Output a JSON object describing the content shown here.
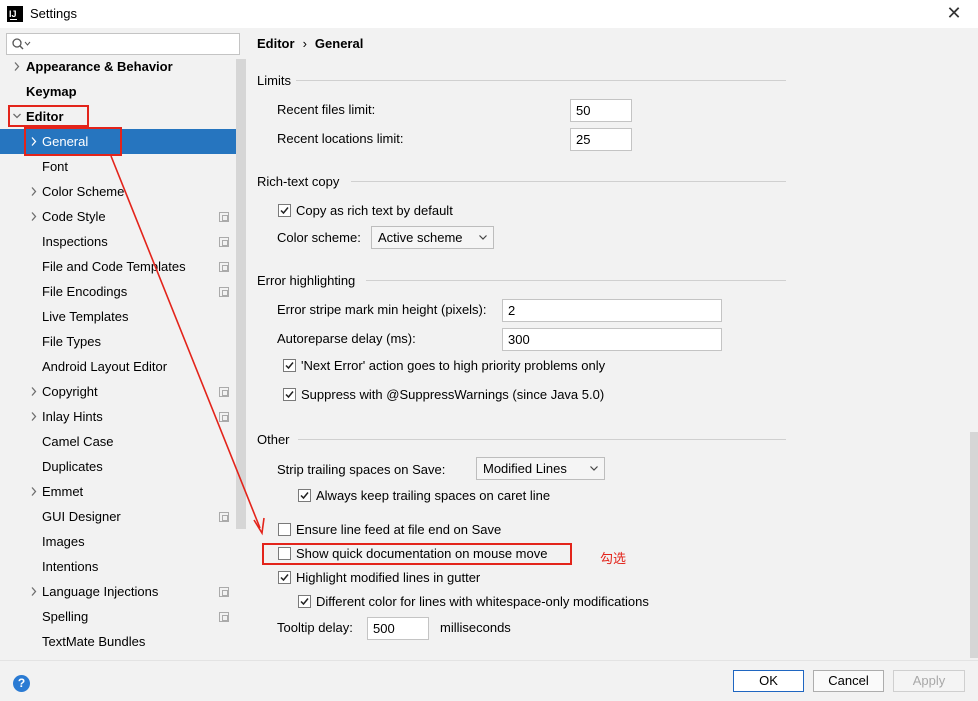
{
  "window": {
    "title": "Settings",
    "app_icon_text": "IJ"
  },
  "search": {
    "placeholder": ""
  },
  "sidebar": {
    "items": [
      {
        "label": "Appearance & Behavior",
        "bold": true,
        "chevron": "right"
      },
      {
        "label": "Keymap",
        "bold": true
      },
      {
        "label": "Editor",
        "bold": true,
        "chevron": "down"
      },
      {
        "label": "General",
        "chevron": "right",
        "selected": true
      },
      {
        "label": "Font"
      },
      {
        "label": "Color Scheme",
        "chevron": "right"
      },
      {
        "label": "Code Style",
        "chevron": "right",
        "project_icon": true
      },
      {
        "label": "Inspections",
        "project_icon": true
      },
      {
        "label": "File and Code Templates",
        "project_icon": true
      },
      {
        "label": "File Encodings",
        "project_icon": true
      },
      {
        "label": "Live Templates"
      },
      {
        "label": "File Types"
      },
      {
        "label": "Android Layout Editor"
      },
      {
        "label": "Copyright",
        "chevron": "right",
        "project_icon": true
      },
      {
        "label": "Inlay Hints",
        "chevron": "right",
        "project_icon": true
      },
      {
        "label": "Camel Case"
      },
      {
        "label": "Duplicates"
      },
      {
        "label": "Emmet",
        "chevron": "right"
      },
      {
        "label": "GUI Designer",
        "project_icon": true
      },
      {
        "label": "Images"
      },
      {
        "label": "Intentions"
      },
      {
        "label": "Language Injections",
        "chevron": "right",
        "project_icon": true
      },
      {
        "label": "Spelling",
        "project_icon": true
      },
      {
        "label": "TextMate Bundles"
      }
    ]
  },
  "breadcrumb": {
    "parent": "Editor",
    "separator": "›",
    "current": "General"
  },
  "limits": {
    "title": "Limits",
    "recent_files_label": "Recent files limit:",
    "recent_files_value": "50",
    "recent_locations_label": "Recent locations limit:",
    "recent_locations_value": "25"
  },
  "rich_text": {
    "title": "Rich-text copy",
    "copy_rich_label": "Copy as rich text by default",
    "copy_rich_checked": true,
    "color_scheme_label": "Color scheme:",
    "color_scheme_value": "Active scheme"
  },
  "error_highlighting": {
    "title": "Error highlighting",
    "stripe_label": "Error stripe mark min height (pixels):",
    "stripe_value": "2",
    "autoreparse_label": "Autoreparse delay (ms):",
    "autoreparse_value": "300",
    "next_error_label": "'Next Error' action goes to high priority problems only",
    "next_error_checked": true,
    "suppress_label": "Suppress with @SuppressWarnings (since Java 5.0)",
    "suppress_checked": true
  },
  "other": {
    "title": "Other",
    "strip_label": "Strip trailing spaces on Save:",
    "strip_value": "Modified Lines",
    "keep_trailing_label": "Always keep trailing spaces on caret line",
    "keep_trailing_checked": true,
    "line_feed_label": "Ensure line feed at file end on Save",
    "line_feed_checked": false,
    "quick_doc_label": "Show quick documentation on mouse move",
    "quick_doc_checked": false,
    "highlight_modified_label": "Highlight modified lines in gutter",
    "highlight_modified_checked": true,
    "different_color_label": "Different color for lines with whitespace-only modifications",
    "different_color_checked": true,
    "tooltip_label": "Tooltip delay:",
    "tooltip_value": "500",
    "tooltip_unit": "milliseconds"
  },
  "annotation": {
    "text": "勾选",
    "color": "#e3241b"
  },
  "footer": {
    "help": "?",
    "ok": "OK",
    "cancel": "Cancel",
    "apply": "Apply"
  },
  "colors": {
    "selection": "#2675bf",
    "annotation": "#e3241b",
    "background": "#f2f2f2"
  }
}
